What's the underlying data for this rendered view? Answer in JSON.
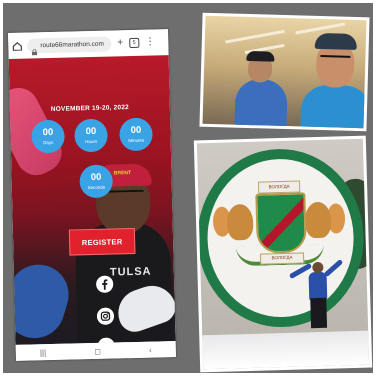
{
  "browser": {
    "url": "route66marathon.com",
    "tab_count": "5",
    "new_tab_label": "+",
    "menu_label": "⋮"
  },
  "site": {
    "date": "NOVEMBER 19-20, 2022",
    "countdown": [
      {
        "value": "00",
        "unit": "Days"
      },
      {
        "value": "00",
        "unit": "Hours"
      },
      {
        "value": "00",
        "unit": "Minutes"
      },
      {
        "value": "00",
        "unit": "Seconds"
      }
    ],
    "register_label": "REGISTER",
    "hat_text": "BRENT",
    "shirt_text": "TULSA",
    "social": [
      "facebook-icon",
      "instagram-icon",
      "twitter-icon"
    ]
  },
  "nav": {
    "recent": "|||",
    "home": "◻",
    "back": "‹"
  },
  "photo_bottom": {
    "crest_top": "ВОЛОГДА",
    "crest_bottom": "ВОЛОГДА"
  },
  "colors": {
    "site_red": "#b81a2a",
    "countdown_blue": "#39a3e6",
    "register_red": "#e1212b",
    "backdrop": "#6e6e6e"
  }
}
